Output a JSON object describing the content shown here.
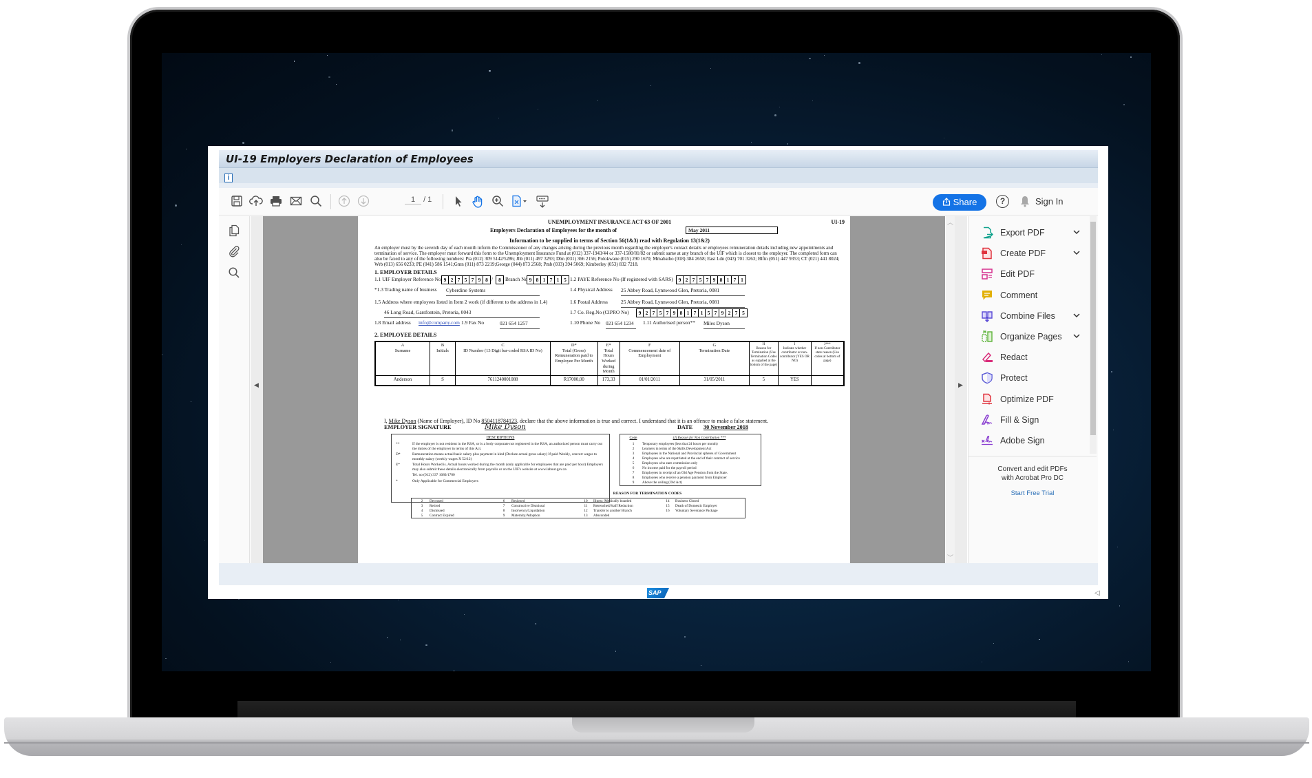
{
  "window": {
    "title": "UI-19 Employers Declaration of Employees",
    "info_icon": "info-icon"
  },
  "toolbar": {
    "icons": [
      "save-icon",
      "upload-cloud-icon",
      "print-icon",
      "email-icon",
      "search-icon",
      "page-up-icon",
      "page-down-icon",
      "select-arrow-icon",
      "hand-icon",
      "zoom-in-icon",
      "page-fit-icon",
      "keyboard-read-icon"
    ],
    "page_current": "1",
    "page_total": "/ 1",
    "share_label": "Share",
    "help_label": "?",
    "sign_in_label": "Sign In"
  },
  "left_rail": {
    "icons": [
      "page-thumbnails-icon",
      "attachment-icon",
      "search-icon"
    ]
  },
  "right_panel": {
    "tools": [
      {
        "label": "Export PDF",
        "has_dropdown": true,
        "color": "#12a38e"
      },
      {
        "label": "Create PDF",
        "has_dropdown": true,
        "color": "#e0343f"
      },
      {
        "label": "Edit PDF",
        "has_dropdown": false,
        "color": "#d6308e"
      },
      {
        "label": "Comment",
        "has_dropdown": false,
        "color": "#e2b007"
      },
      {
        "label": "Combine Files",
        "has_dropdown": true,
        "color": "#5b4bd6"
      },
      {
        "label": "Organize Pages",
        "has_dropdown": true,
        "color": "#5db33a"
      },
      {
        "label": "Redact",
        "has_dropdown": false,
        "color": "#d92c7a"
      },
      {
        "label": "Protect",
        "has_dropdown": false,
        "color": "#5b5bd6"
      },
      {
        "label": "Optimize PDF",
        "has_dropdown": false,
        "color": "#e0343f"
      },
      {
        "label": "Fill & Sign",
        "has_dropdown": false,
        "color": "#8a3fd1"
      },
      {
        "label": "Adobe Sign",
        "has_dropdown": false,
        "color": "#8a3fd1"
      }
    ],
    "promo_line1": "Convert and edit PDFs",
    "promo_line2": "with Acrobat Pro DC",
    "promo_cta": "Start Free Trial"
  },
  "document": {
    "act_title": "UNEMPLOYMENT INSURANCE ACT 63 OF 2001",
    "form_code": "UI-19",
    "month_label": "Employers Declaration of Employees for the month of",
    "month_value": "May 2011",
    "subtitle": "Information to be supplied in terms of Section 56(1&3) read with Regulation 13(1&2)",
    "intro": "An employer must by the seventh day of each month inform the Commissioner of any changes arising during the previous month regarding the employer's contact details or employees remuneration details including new appointments and termination of service. The employer must forward this form to the Unemployment Insurance Fund at (012) 337-1943/44 or 337-1580/81/82 or submit same at any branch of the UIF which is closest to the employer. The completed form can also be faxed to any of the following numbers: Pta (012) 309 5142/5286; Jhb (011) 497 3293; Dbn (031) 366 2156; Polokwane (015) 290 1670; Mmabatho (018) 384 2658; East Ldn (043) 701 3263; Blftn (051) 447 9353; CT (021) 441 8024; Wrb (013) 656 0233; PE (041) 586 1541;Gmn (011) 873 2219;George (044) 873 2568; Pmb (033) 394 5069; Kimberley (053) 832 7218.",
    "section1": "1. EMPLOYER DETAILS",
    "employer": {
      "uif_ref_label": "1.1  UIF Employer Reference No",
      "uif_ref_digits": [
        "9",
        "2",
        "7",
        "5",
        "7",
        "9",
        "8"
      ],
      "uif_ref_suffix": [
        "8"
      ],
      "branch_label": "Branch No",
      "branch_digits": [
        "9",
        "8",
        "1",
        "7",
        "1",
        "5"
      ],
      "paye_label": "1.2  PAYE Reference No (If registered with SARS)",
      "paye_digits": [
        "9",
        "2",
        "7",
        "5",
        "7",
        "9",
        "8",
        "1",
        "7",
        "1"
      ],
      "trading_label": "*1.3  Trading name of business",
      "trading_value": "Cyberdine Systems",
      "physical_label": "1.4  Physical Address",
      "physical_value": "25 Abbey Road, Lynnwood Glen, Pretoria, 0081",
      "work_addr_label": "1.5  Address where employees listed in Item 2 work (if different to the address in 1.4)",
      "work_addr_value": "46 Long Road, Garsfontein, Pretoria, 0043",
      "postal_label": "1.6  Postal Address",
      "postal_value": "25 Abbey Road, Lynnwood Glen, Pretoria, 0081",
      "coreg_label": "1.7  Co. Reg.No (CIPRO No)",
      "coreg_digits": [
        "9",
        "2",
        "7",
        "5",
        "7",
        "9",
        "8",
        "1",
        "7",
        "1",
        "5",
        "7",
        "9",
        "2",
        "7",
        "5"
      ],
      "email_label": "1.8  Email address",
      "email_value": "info@company.com",
      "fax_label": "1.9  Fax No",
      "fax_value": "021 654 1257",
      "phone_label": "1.10  Phone No",
      "phone_value": "021 654 1234",
      "auth_label": "1.11  Authorised person**",
      "auth_value": "Miles Dyson"
    },
    "section2": "2. EMPLOYEE DETAILS",
    "employee_table": {
      "headers": [
        {
          "code": "A",
          "text": "Surname"
        },
        {
          "code": "B",
          "text": "Initials"
        },
        {
          "code": "C",
          "text": "ID Number (13 Digit bar-coded RSA ID No)"
        },
        {
          "code": "D*",
          "text": "Total (Gross) Remuneration paid to Employee Per Month"
        },
        {
          "code": "E*",
          "text": "Total Hours Worked during Month"
        },
        {
          "code": "F",
          "text": "Commencement date of Employment"
        },
        {
          "code": "G",
          "text": "Termination Date"
        },
        {
          "code": "H",
          "text": "Reason for Termination (Use Termination Codes as supplied at the bottom of the page)"
        },
        {
          "code": "I",
          "text": "Indicate whether contributor or non-contributor (YES OR NO)"
        },
        {
          "code": "J***",
          "text": "If non-Contributor state reason (Use codes at bottom of page)"
        }
      ],
      "rows": [
        [
          "Anderson",
          "S",
          "7611240001088",
          "R17000,00",
          "173,33",
          "01/01/2011",
          "31/05/2011",
          "5",
          "YES",
          ""
        ]
      ]
    },
    "declaration": {
      "prefix": "I, ",
      "name": "Mike Dyson",
      "middle": " (Name of Employer), ID No ",
      "id_no": "8504118784123",
      "suffix": ", declare that the above information is true and correct.  I understand that it is an offence to make a false statement.",
      "signature_label": "EMPLOYER SIGNATURE",
      "signature_value": "Mike Dyson",
      "date_label": "DATE",
      "date_value": "30 November 2018"
    },
    "descriptions": {
      "heading": "DESCRIPTIONS",
      "items": [
        {
          "key": "**",
          "text": "If the employer is not resident in the RSA, or is a body corporate not registered in the RSA, an authorized person must carry out the duties of the employer in terms of this Act."
        },
        {
          "key": "D*",
          "text": "Remuneration means actual basic salary plus payment in kind (Declare actual gross salary) If paid Weekly, convert wages to monthly salary  (weekly wages X 52/12)"
        },
        {
          "key": "E*",
          "text": "Total Hours Worked is.  Actual hours worked during the month (only applicable for employees that are paid per hour) Employers may also submit these details electronically from payrolls or on the UIF's website at www.labour.gov.za"
        },
        {
          "key": "",
          "text": "Tel. no (012) 337 1680/1700"
        },
        {
          "key": "*",
          "text": "Only Applicable for Commercial Employers"
        }
      ]
    },
    "non_contribution": {
      "code_heading": "Code",
      "heading": "(J) Reason for Non Contribution ***",
      "items": [
        {
          "code": "1",
          "text": "Temporary employees (less that 24 hours per month)"
        },
        {
          "code": "2",
          "text": "Learners in terms of the Skills Development Act"
        },
        {
          "code": "3",
          "text": "Employees in the National and Provincial spheres of Government"
        },
        {
          "code": "4",
          "text": "Employees who are repatriated at the end of their contract of service"
        },
        {
          "code": "5",
          "text": "Employees who earn commission only"
        },
        {
          "code": "6",
          "text": "No income paid for the payroll period"
        },
        {
          "code": "7",
          "text": "Employees in receipt of an Old Age Pension from the State."
        },
        {
          "code": "8",
          "text": "Employees who receive a pension payment from Employer"
        },
        {
          "code": "9",
          "text": "Above the ceiling (Old Act)"
        }
      ]
    },
    "termination_codes": {
      "heading": "REASON FOR TERMINATION CODES",
      "columns": [
        [
          {
            "code": "2",
            "text": "Deceased"
          },
          {
            "code": "3",
            "text": "Retired"
          },
          {
            "code": "4",
            "text": "Dismissed"
          },
          {
            "code": "5",
            "text": "Contract Expired"
          }
        ],
        [
          {
            "code": "6",
            "text": "Resigned"
          },
          {
            "code": "7",
            "text": "Constructive Dismissal"
          },
          {
            "code": "8",
            "text": "Insolvency/Liquidation"
          },
          {
            "code": "9",
            "text": "Maternity/Adoption"
          }
        ],
        [
          {
            "code": "10",
            "text": "Illness /Medically boarded"
          },
          {
            "code": "11",
            "text": "Retrenched/Staff Reduction"
          },
          {
            "code": "12",
            "text": "Transfer to another Branch"
          },
          {
            "code": "13",
            "text": "Absconded"
          }
        ],
        [
          {
            "code": "14",
            "text": "Business Closed"
          },
          {
            "code": "15",
            "text": "Death of Domestic Employer"
          },
          {
            "code": "16",
            "text": "Voluntary Severance Package"
          }
        ]
      ]
    }
  },
  "footer": {
    "logo_text": "SAP"
  }
}
